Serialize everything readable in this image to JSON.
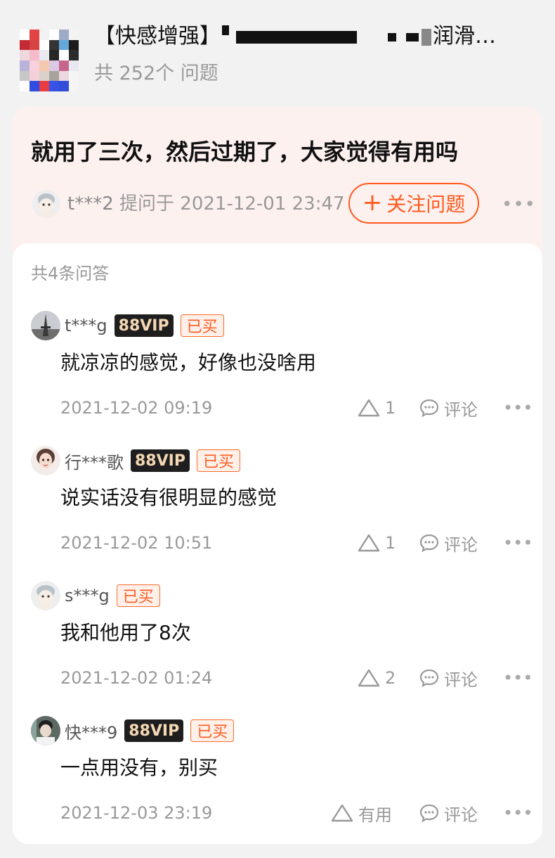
{
  "product": {
    "title_prefix": "【快感增强】",
    "title_suffix": "润滑…",
    "question_count": "共 252个 问题"
  },
  "question": {
    "title": "就用了三次，然后过期了，大家觉得有用吗",
    "asker": "t***2",
    "asked_label": "提问于 2021-12-01 23:47",
    "follow_label": "关注问题",
    "more": "•••"
  },
  "answers": {
    "count_label": "共4条问答",
    "comment_label": "评论",
    "vip_label": "88VIP",
    "bought_label": "已买",
    "more": "•••",
    "items": [
      {
        "user": "t***g",
        "vip": true,
        "bought": true,
        "text": "就凉凉的感觉，好像也没啥用",
        "time": "2021-12-02 09:19",
        "likes": "1"
      },
      {
        "user": "行***歌",
        "vip": true,
        "bought": true,
        "text": "说实话没有很明显的感觉",
        "time": "2021-12-02 10:51",
        "likes": "1"
      },
      {
        "user": "s***g",
        "vip": false,
        "bought": true,
        "text": "我和他用了8次",
        "time": "2021-12-02 01:24",
        "likes": "2"
      },
      {
        "user": "快***9",
        "vip": true,
        "bought": true,
        "text": "一点用没有，别买",
        "time": "2021-12-03 23:19",
        "likes": "有用"
      }
    ]
  },
  "colors": {
    "accent": "#ff5a1f",
    "question_bg": "#fdf1ef",
    "vip_bg": "#1e1e1e",
    "vip_text": "#f4d7b4"
  }
}
